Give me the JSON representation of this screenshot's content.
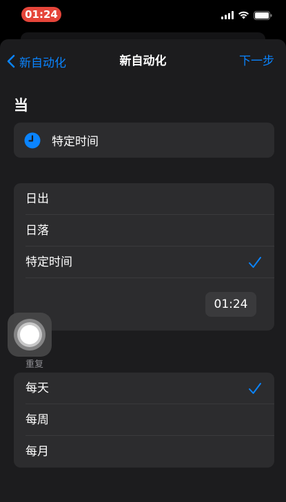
{
  "status_bar": {
    "time": "01:24",
    "icons": [
      "cellular-signal-icon",
      "wifi-icon",
      "battery-icon"
    ]
  },
  "nav": {
    "back_label": "新自动化",
    "title": "新自动化",
    "next_label": "下一步"
  },
  "when": {
    "heading": "当",
    "trigger_label": "特定时间",
    "trigger_icon": "clock-icon"
  },
  "time_options": {
    "items": [
      {
        "label": "日出",
        "selected": false
      },
      {
        "label": "日落",
        "selected": false
      },
      {
        "label": "特定时间",
        "selected": true
      }
    ],
    "time_value": "01:24"
  },
  "repeat": {
    "heading": "重复",
    "items": [
      {
        "label": "每天",
        "selected": true
      },
      {
        "label": "每周",
        "selected": false
      },
      {
        "label": "每月",
        "selected": false
      }
    ]
  },
  "colors": {
    "accent": "#0a84ff",
    "time_pill": "#e5453a",
    "background": "#1c1c1e",
    "cell": "#2c2c2e"
  }
}
